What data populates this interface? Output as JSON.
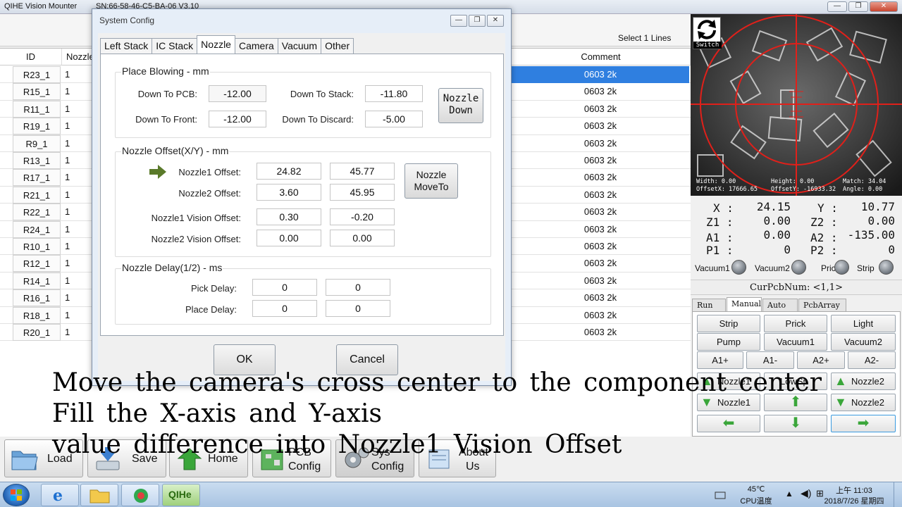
{
  "app": {
    "title": "QIHE Vision Mounter",
    "sn": "SN:66-58-46-C5-BA-06   V3.10",
    "select_lines": "Select  1 Lines"
  },
  "window_controls": {
    "minimize": "—",
    "maximize": "❐",
    "close": "✕"
  },
  "table": {
    "headers": {
      "id": "ID",
      "nozzle": "Nozzle",
      "comment": "Comment"
    },
    "rows": [
      {
        "id": "R23_1",
        "nozzle": "1",
        "comment": "0603 2k"
      },
      {
        "id": "R15_1",
        "nozzle": "1",
        "comment": "0603 2k"
      },
      {
        "id": "R11_1",
        "nozzle": "1",
        "comment": "0603 2k"
      },
      {
        "id": "R19_1",
        "nozzle": "1",
        "comment": "0603 2k"
      },
      {
        "id": "R9_1",
        "nozzle": "1",
        "comment": "0603 2k"
      },
      {
        "id": "R13_1",
        "nozzle": "1",
        "comment": "0603 2k"
      },
      {
        "id": "R17_1",
        "nozzle": "1",
        "comment": "0603 2k"
      },
      {
        "id": "R21_1",
        "nozzle": "1",
        "comment": "0603 2k"
      },
      {
        "id": "R22_1",
        "nozzle": "1",
        "comment": "0603 2k"
      },
      {
        "id": "R24_1",
        "nozzle": "1",
        "comment": "0603 2k"
      },
      {
        "id": "R10_1",
        "nozzle": "1",
        "comment": "0603 2k"
      },
      {
        "id": "R12_1",
        "nozzle": "1",
        "comment": "0603 2k"
      },
      {
        "id": "R14_1",
        "nozzle": "1",
        "comment": "0603 2k"
      },
      {
        "id": "R16_1",
        "nozzle": "1",
        "comment": "0603 2k"
      },
      {
        "id": "R18_1",
        "nozzle": "1",
        "comment": "0603 2k"
      },
      {
        "id": "R20_1",
        "nozzle": "1",
        "comment": "0603 2k"
      }
    ]
  },
  "camera": {
    "switch_label": "Switch",
    "width": "Width:  0.00",
    "height": "Height:  0.00",
    "match": "Match: 34.04",
    "offset_x": "OffsetX: 17666.65",
    "offset_y": "OffsetY: -16933.32",
    "angle": "Angle: 0.00"
  },
  "axes": {
    "x_label": "X :",
    "x": "24.15",
    "y_label": "Y :",
    "y": "10.77",
    "z1_label": "Z1 :",
    "z1": "0.00",
    "z2_label": "Z2 :",
    "z2": "0.00",
    "a1_label": "A1 :",
    "a1": "0.00",
    "a2_label": "A2 :",
    "a2": "-135.00",
    "p1_label": "P1 :",
    "p1": "0",
    "p2_label": "P2 :",
    "p2": "0"
  },
  "status_leds": {
    "vacuum1": "Vacuum1",
    "vacuum2": "Vacuum2",
    "prick": "Prick",
    "strip": "Strip"
  },
  "cur_pcb": "CurPcbNum: <1,1>",
  "control_tabs": [
    "Run",
    "Manual",
    "Auto",
    "PcbArray"
  ],
  "control_buttons": {
    "strip": "Strip",
    "prick": "Prick",
    "light": "Light",
    "pump": "Pump",
    "vacuum1": "Vacuum1",
    "vacuum2": "Vacuum2",
    "a1_plus": "A1+",
    "a1_minus": "A1-",
    "a2_plus": "A2+",
    "a2_minus": "A2-",
    "nozzle1_up": "Nozzle1",
    "low_speed": "LowSp",
    "nozzle2_up": "Nozzle2",
    "nozzle1_down": "Nozzle1",
    "nozzle2_down": "Nozzle2"
  },
  "dialog": {
    "title": "System Config",
    "tabs": [
      "Left Stack",
      "IC Stack",
      "Nozzle",
      "Camera",
      "Vacuum",
      "Other"
    ],
    "active_tab": "Nozzle",
    "place_blowing": {
      "title": "Place Blowing - mm",
      "down_to_pcb_label": "Down To PCB:",
      "down_to_pcb": "-12.00",
      "down_to_stack_label": "Down To Stack:",
      "down_to_stack": "-11.80",
      "down_to_front_label": "Down To Front:",
      "down_to_front": "-12.00",
      "down_to_discard_label": "Down To Discard:",
      "down_to_discard": "-5.00",
      "nozzle_down_line1": "Nozzle",
      "nozzle_down_line2": "Down"
    },
    "nozzle_offset": {
      "title": "Nozzle Offset(X/Y) - mm",
      "n1_label": "Nozzle1 Offset:",
      "n1_x": "24.82",
      "n1_y": "45.77",
      "n2_label": "Nozzle2 Offset:",
      "n2_x": "3.60",
      "n2_y": "45.95",
      "n1v_label": "Nozzle1 Vision Offset:",
      "n1v_x": "0.30",
      "n1v_y": "-0.20",
      "n2v_label": "Nozzle2 Vision Offset:",
      "n2v_x": "0.00",
      "n2v_y": "0.00",
      "move_line1": "Nozzle",
      "move_line2": "MoveTo"
    },
    "nozzle_delay": {
      "title": "Nozzle Delay(1/2) - ms",
      "pick_label": "Pick Delay:",
      "pick_1": "0",
      "pick_2": "0",
      "place_label": "Place Delay:",
      "place_1": "0",
      "place_2": "0"
    },
    "ok": "OK",
    "cancel": "Cancel"
  },
  "toolbar": {
    "load": "Load",
    "save": "Save",
    "home": "Home",
    "pcb_config_line1": "PCB",
    "pcb_config_line2": "Config",
    "sys_config_line1": "Sys",
    "sys_config_line2": "Config",
    "about_line1": "About",
    "about_line2": "Us"
  },
  "subtitle": {
    "line1": "Move the camera's cross center to the component center",
    "line2": "Fill the X-axis and Y-axis",
    "line3": "value difference into Nozzle1 Vision Offset"
  },
  "taskbar": {
    "qihe_label": "QIHe",
    "temp": "45℃",
    "temp_label": "CPU温度",
    "time": "上午 11:03",
    "date": "2018/7/26 星期四"
  },
  "colors": {
    "selection": "#2f7fe0",
    "crosshair": "#e0201a",
    "arrow_green": "#3aa63a",
    "arrow_indicator": "#5a7a2a"
  }
}
